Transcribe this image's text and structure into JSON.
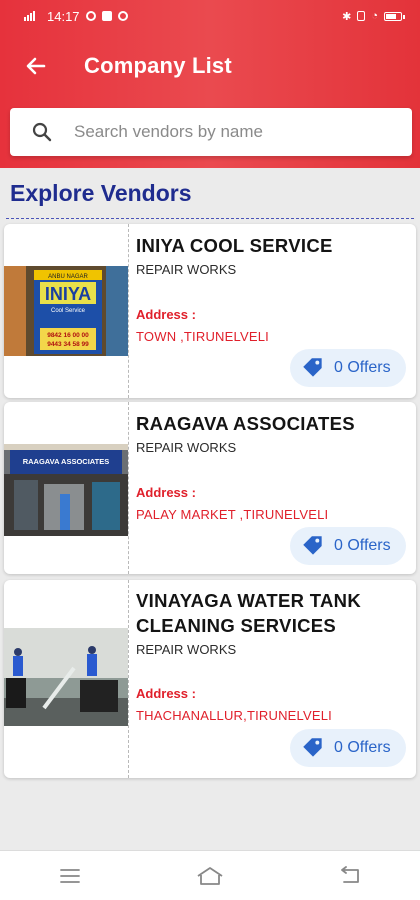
{
  "status_bar": {
    "time": "14:17"
  },
  "header": {
    "title": "Company List"
  },
  "search": {
    "placeholder": "Search vendors by name"
  },
  "section": {
    "title": "Explore Vendors"
  },
  "vendors": [
    {
      "name": "INIYA COOL SERVICE",
      "category": "REPAIR WORKS",
      "address_label": "Address :",
      "address": "TOWN ,TIRUNELVELI",
      "offers": "0 Offers",
      "sign_text": [
        "ANBU NAGAR",
        "INIYA",
        "Cool Service",
        "9842 16 00 00",
        "9443 34 58 99"
      ]
    },
    {
      "name": "RAAGAVA ASSOCIATES",
      "category": "REPAIR WORKS",
      "address_label": "Address :",
      "address": "PALAY MARKET ,TIRUNELVELI",
      "offers": "0 Offers",
      "sign_text": [
        "RAAGAVA ASSOCIATES"
      ]
    },
    {
      "name": "VINAYAGA WATER TANK CLEANING SERVICES",
      "category": "REPAIR WORKS",
      "address_label": "Address :",
      "address": "THACHANALLUR,TIRUNELVELI",
      "offers": "0 Offers"
    }
  ],
  "colors": {
    "header": "#e6323c",
    "section_title": "#1f2c8f",
    "address": "#e0202b",
    "offers_text": "#2a64c8",
    "offers_bg": "#e8f1fb"
  },
  "icons": {
    "back": "arrow-left-icon",
    "search": "search-icon",
    "offer": "tag-icon",
    "nav": [
      "menu-icon",
      "home-icon",
      "back-icon"
    ]
  }
}
